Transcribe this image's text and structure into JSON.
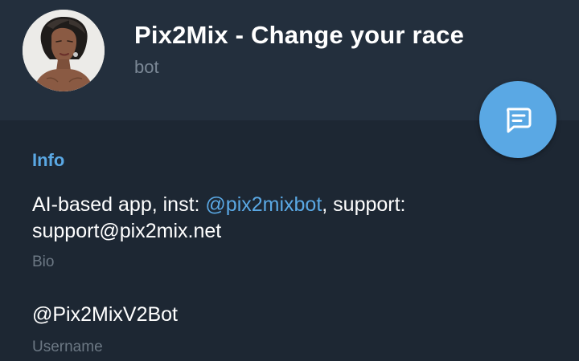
{
  "header": {
    "title": "Pix2Mix - Change your race",
    "subtitle": "bot"
  },
  "fab": {
    "icon": "message-icon"
  },
  "info": {
    "section_title": "Info",
    "bio": {
      "text_before": "AI-based app, inst: ",
      "mention": "@pix2mixbot",
      "text_after": ", support: support@pix2mix.net",
      "label": "Bio"
    },
    "username": {
      "value": "@Pix2MixV2Bot",
      "label": "Username"
    }
  },
  "colors": {
    "background": "#1d2733",
    "header_background": "#232f3d",
    "accent": "#5aa8e4",
    "secondary_text": "#7b8896"
  }
}
